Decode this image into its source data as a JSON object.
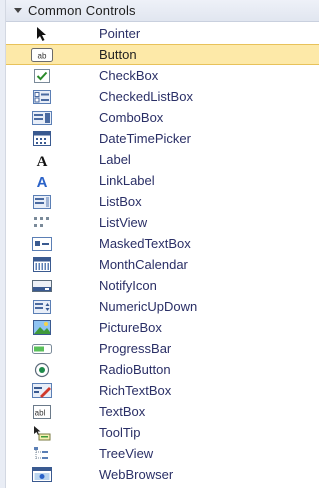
{
  "category": {
    "title": "Common Controls"
  },
  "items": [
    {
      "label": "Pointer",
      "icon": "pointer-icon"
    },
    {
      "label": "Button",
      "icon": "button-icon",
      "selected": true
    },
    {
      "label": "CheckBox",
      "icon": "checkbox-icon"
    },
    {
      "label": "CheckedListBox",
      "icon": "checkedlistbox-icon"
    },
    {
      "label": "ComboBox",
      "icon": "combobox-icon"
    },
    {
      "label": "DateTimePicker",
      "icon": "datetimepicker-icon"
    },
    {
      "label": "Label",
      "icon": "label-icon"
    },
    {
      "label": "LinkLabel",
      "icon": "linklabel-icon"
    },
    {
      "label": "ListBox",
      "icon": "listbox-icon"
    },
    {
      "label": "ListView",
      "icon": "listview-icon"
    },
    {
      "label": "MaskedTextBox",
      "icon": "maskedtextbox-icon"
    },
    {
      "label": "MonthCalendar",
      "icon": "monthcalendar-icon"
    },
    {
      "label": "NotifyIcon",
      "icon": "notifyicon-icon"
    },
    {
      "label": "NumericUpDown",
      "icon": "numericupdown-icon"
    },
    {
      "label": "PictureBox",
      "icon": "picturebox-icon"
    },
    {
      "label": "ProgressBar",
      "icon": "progressbar-icon"
    },
    {
      "label": "RadioButton",
      "icon": "radiobutton-icon"
    },
    {
      "label": "RichTextBox",
      "icon": "richtextbox-icon"
    },
    {
      "label": "TextBox",
      "icon": "textbox-icon"
    },
    {
      "label": "ToolTip",
      "icon": "tooltip-icon"
    },
    {
      "label": "TreeView",
      "icon": "treeview-icon"
    },
    {
      "label": "WebBrowser",
      "icon": "webbrowser-icon"
    }
  ],
  "colors": {
    "selected_bg": "#fde9a8",
    "selected_border": "#e8c25a",
    "label_text": "#2a2f66"
  }
}
